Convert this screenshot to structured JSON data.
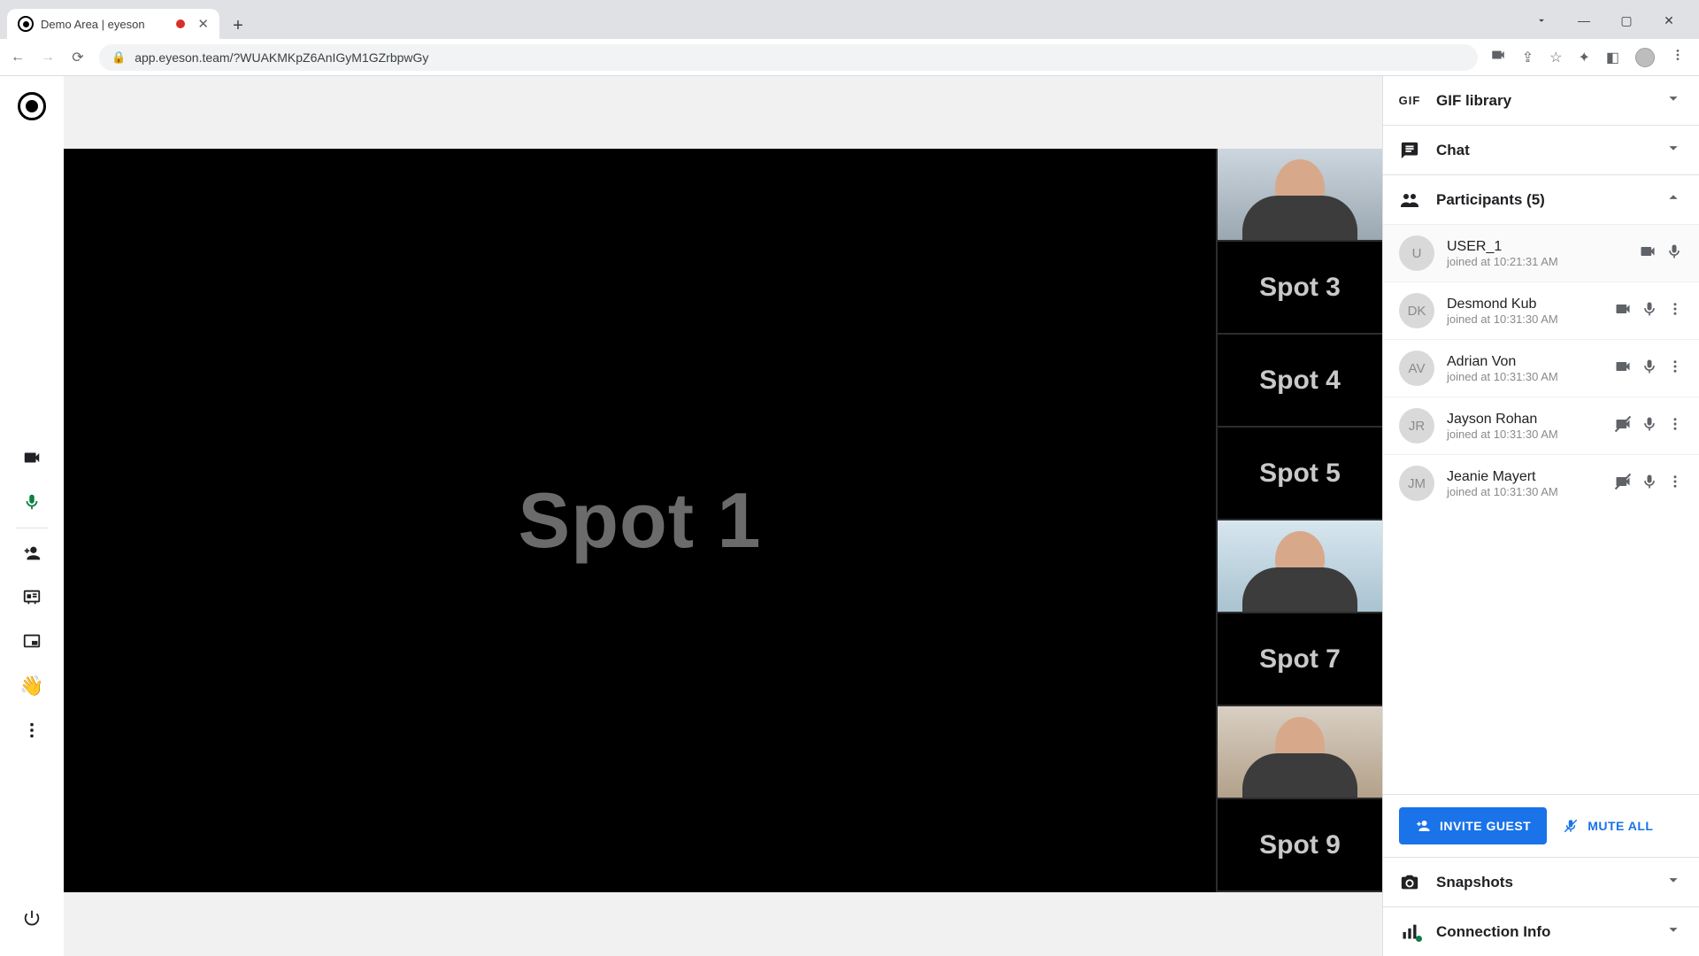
{
  "browser": {
    "tab_title": "Demo Area | eyeson",
    "url": "app.eyeson.team/?WUAKMKpZ6AnIGyM1GZrbpwGy"
  },
  "stage": {
    "main_spot": "Spot 1",
    "side_slots": [
      {
        "type": "video"
      },
      {
        "type": "spot",
        "label": "Spot 3"
      },
      {
        "type": "spot",
        "label": "Spot 4"
      },
      {
        "type": "spot",
        "label": "Spot 5"
      },
      {
        "type": "video"
      },
      {
        "type": "spot",
        "label": "Spot 7"
      },
      {
        "type": "video"
      },
      {
        "type": "spot",
        "label": "Spot 9"
      }
    ]
  },
  "sidebar": {
    "gif_label": "GIF library",
    "gif_chip": "GIF",
    "chat_label": "Chat",
    "participants_label": "Participants (5)",
    "snapshots_label": "Snapshots",
    "connection_label": "Connection Info",
    "invite_label": "INVITE GUEST",
    "muteall_label": "MUTE ALL"
  },
  "participants": [
    {
      "initials": "U",
      "name": "USER_1",
      "joined": "joined at 10:21:31 AM",
      "cam": "on",
      "show_more": false
    },
    {
      "initials": "DK",
      "name": "Desmond Kub",
      "joined": "joined at 10:31:30 AM",
      "cam": "on",
      "show_more": true
    },
    {
      "initials": "AV",
      "name": "Adrian Von",
      "joined": "joined at 10:31:30 AM",
      "cam": "on",
      "show_more": true
    },
    {
      "initials": "JR",
      "name": "Jayson Rohan",
      "joined": "joined at 10:31:30 AM",
      "cam": "off",
      "show_more": true
    },
    {
      "initials": "JM",
      "name": "Jeanie Mayert",
      "joined": "joined at 10:31:30 AM",
      "cam": "off",
      "show_more": true
    }
  ]
}
